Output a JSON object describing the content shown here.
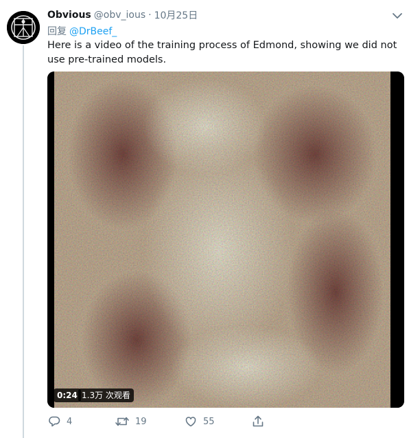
{
  "tweet": {
    "display_name": "Obvious",
    "handle": "@obv_ious",
    "separator": "·",
    "date": "10月25日",
    "reply_prefix": "回复",
    "reply_to": "@DrBeef_",
    "text": "Here is a video of the training process of Edmond, showing we did not use pre-trained models."
  },
  "video": {
    "duration": "0:24",
    "views": "1.3万 次观看"
  },
  "actions": {
    "reply_count": "4",
    "retweet_count": "19",
    "like_count": "55"
  },
  "icons": {
    "avatar": "vitruvian-avatar-icon",
    "caret": "chevron-down-icon",
    "reply": "reply-icon",
    "retweet": "retweet-icon",
    "like": "heart-icon",
    "share": "share-icon"
  },
  "colors": {
    "link": "#1da1f2",
    "secondary_text": "#657786",
    "primary_text": "#14171a"
  }
}
